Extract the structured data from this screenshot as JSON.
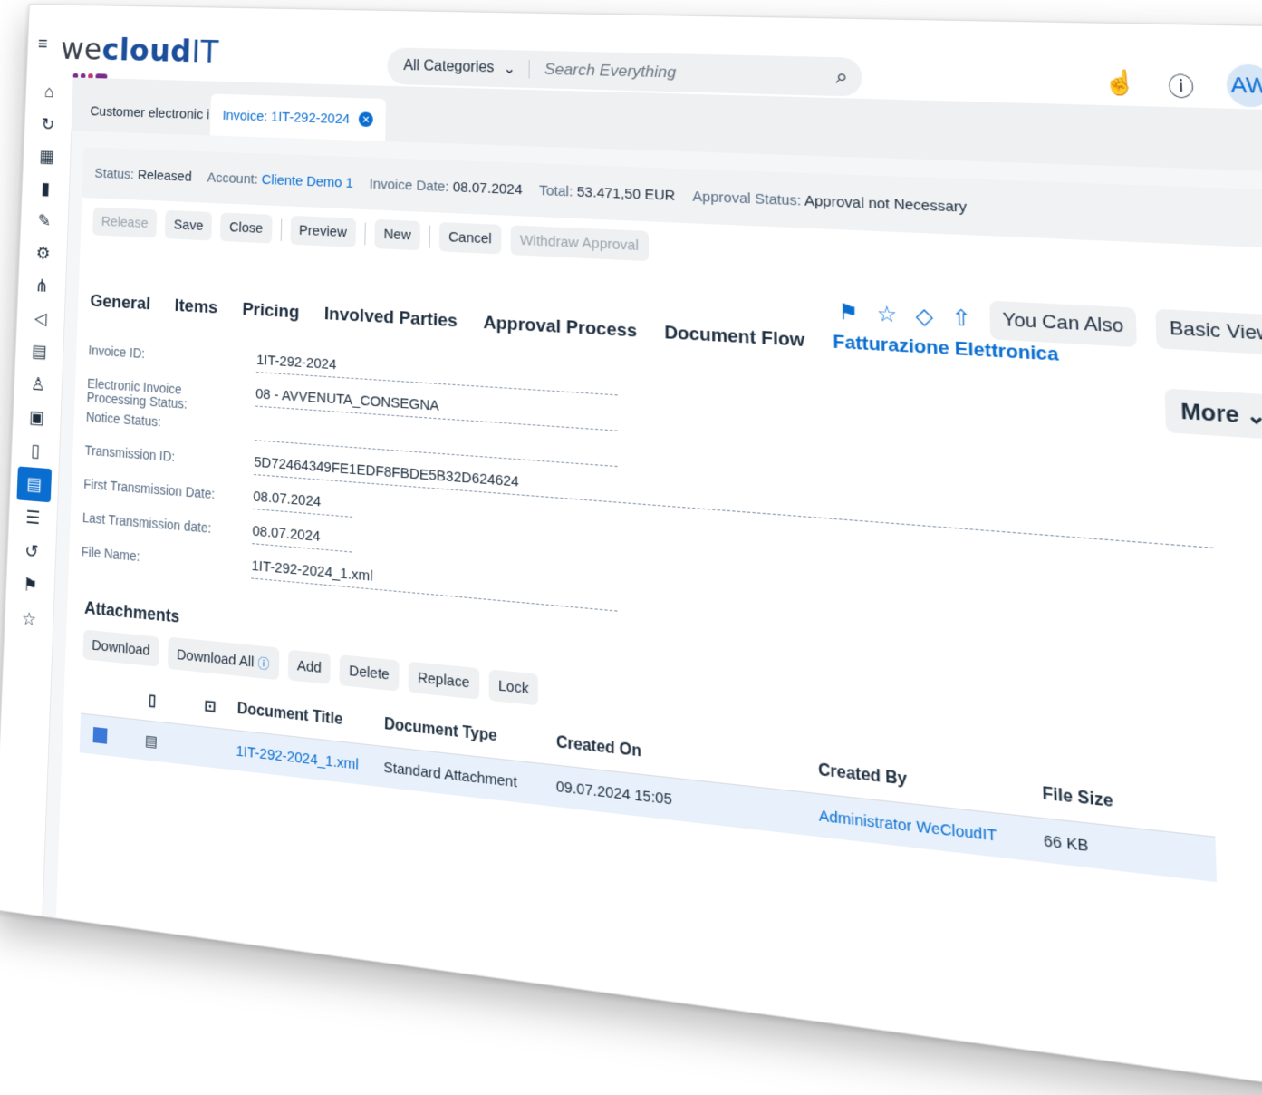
{
  "shell": {
    "menu_icon": "hamburger-icon",
    "logo": {
      "we": "we",
      "cloud": "cloud",
      "it": "IT"
    },
    "search": {
      "category": "All Categories",
      "placeholder": "Search Everything"
    },
    "avatar_initials": "AW"
  },
  "tabs": [
    {
      "label": "Customer electronic in..."
    },
    {
      "label": "Invoice: 1IT-292-2024"
    }
  ],
  "summary": {
    "status_label": "Status:",
    "status_value": "Released",
    "account_label": "Account:",
    "account_value": "Cliente Demo 1",
    "invoice_date_label": "Invoice Date:",
    "invoice_date_value": "08.07.2024",
    "total_label": "Total:",
    "total_value": "53.471,50 EUR",
    "approval_label": "Approval Status:",
    "approval_value": "Approval not Necessary"
  },
  "toolbar": {
    "release": "Release",
    "save": "Save",
    "close": "Close",
    "preview": "Preview",
    "new": "New",
    "cancel": "Cancel",
    "withdraw": "Withdraw Approval"
  },
  "actions": {
    "you_can_also": "You Can Also",
    "basic_view": "Basic View",
    "more": "More"
  },
  "sections": [
    "General",
    "Items",
    "Pricing",
    "Involved Parties",
    "Approval Process",
    "Document Flow",
    "Fatturazione Elettronica"
  ],
  "form": [
    {
      "label": "Invoice ID:",
      "value": "1IT-292-2024"
    },
    {
      "label": "Electronic Invoice Processing Status:",
      "value": "08 - AVVENUTA_CONSEGNA"
    },
    {
      "label": "Notice Status:",
      "value": ""
    },
    {
      "label": "Transmission ID:",
      "value": "5D72464349FE1EDF8FBDE5B32D624624"
    },
    {
      "label": "First Transmission Date:",
      "value": "08.07.2024"
    },
    {
      "label": "Last Transmission date:",
      "value": "08.07.2024"
    },
    {
      "label": "File Name:",
      "value": "1IT-292-2024_1.xml"
    }
  ],
  "attachments": {
    "title": "Attachments",
    "buttons": {
      "download": "Download",
      "download_all": "Download All",
      "add": "Add",
      "delete": "Delete",
      "replace": "Replace",
      "lock": "Lock"
    },
    "columns": {
      "title": "Document Title",
      "type": "Document Type",
      "created_on": "Created On",
      "created_by": "Created By",
      "size": "File Size"
    },
    "rows": [
      {
        "title": "1IT-292-2024_1.xml",
        "type": "Standard Attachment",
        "created_on": "09.07.2024 15:05",
        "created_by": "Administrator WeCloudIT",
        "size": "66  KB"
      }
    ]
  }
}
